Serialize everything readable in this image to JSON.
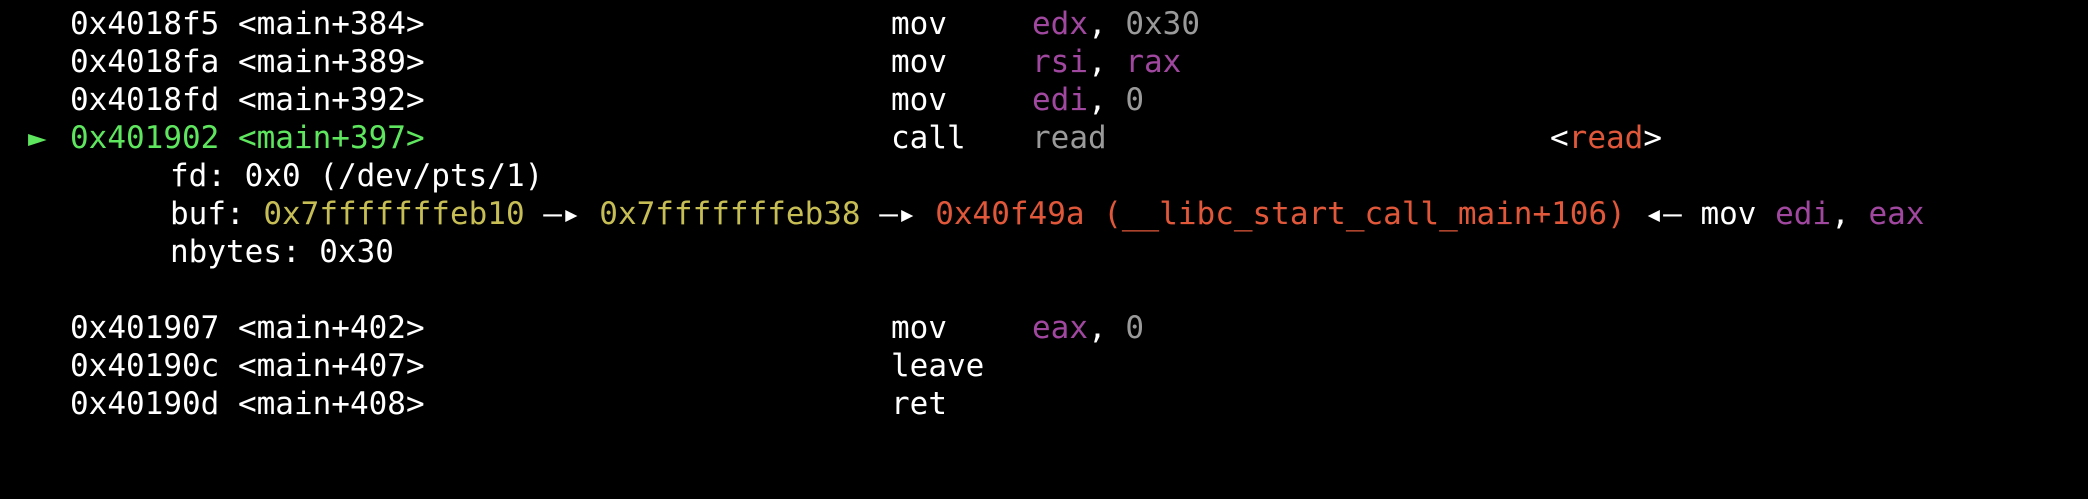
{
  "theme": {
    "background": "#000000",
    "text": "#ffffff",
    "current": "#5fe65f",
    "register": "#a0479f",
    "immediate": "#9a9a9a",
    "symbol": "#e0573a",
    "stack_ptr": "#c6bd55"
  },
  "disasm": {
    "current_marker": "►",
    "pre": [
      {
        "addr": "0x4018f5 <main+384>",
        "mnem": "mov",
        "op1": "edx",
        "sep": ", ",
        "op2": "0x30"
      },
      {
        "addr": "0x4018fa <main+389>",
        "mnem": "mov",
        "op1": "rsi",
        "sep": ", ",
        "op2": "rax"
      },
      {
        "addr": "0x4018fd <main+392>",
        "mnem": "mov",
        "op1": "edi",
        "sep": ", ",
        "op2": "0"
      }
    ],
    "current": {
      "addr": "0x401902 <main+397>",
      "mnem": "call",
      "target": "read",
      "ann_open": "<",
      "ann_sym": "read",
      "ann_close": ">"
    },
    "args": {
      "fd": "fd: 0x0 (/dev/pts/1)",
      "buf_label": "buf: ",
      "buf_ptr1": "0x7fffffffeb10",
      "arrow1": " —▸ ",
      "buf_ptr2": "0x7fffffffeb38",
      "arrow2": " —▸ ",
      "buf_sym": "0x40f49a (__libc_start_call_main+106)",
      "arrow3": " ◂— ",
      "buf_ins": "mov ",
      "buf_reg1": "edi",
      "buf_sep": ", ",
      "buf_reg2": "eax",
      "nbytes": "nbytes: 0x30"
    },
    "post": [
      {
        "addr": "0x401907 <main+402>",
        "mnem": "mov",
        "op1": "eax",
        "sep": ", ",
        "op2": "0"
      },
      {
        "addr": "0x40190c <main+407>",
        "mnem": "leave"
      },
      {
        "addr": "0x40190d <main+408>",
        "mnem": "ret"
      }
    ]
  }
}
